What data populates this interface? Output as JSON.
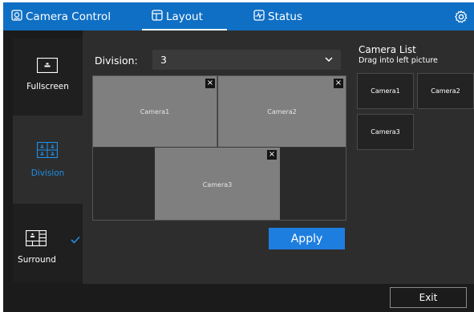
{
  "tabs": [
    {
      "label": "Camera Control",
      "icon": "camera-control-icon",
      "active": false
    },
    {
      "label": "Layout",
      "icon": "layout-icon",
      "active": true
    },
    {
      "label": "Status",
      "icon": "status-icon",
      "active": false
    }
  ],
  "settings_icon": "gear-icon",
  "sidebar": {
    "items": [
      {
        "label": "Fullscreen",
        "icon": "fullscreen-icon",
        "selected": false
      },
      {
        "label": "Division",
        "icon": "division-icon",
        "selected": true
      },
      {
        "label": "Surround",
        "icon": "surround-icon",
        "selected": false,
        "checked": true
      }
    ]
  },
  "division": {
    "label": "Division:",
    "value": "3"
  },
  "grid": {
    "cells": [
      {
        "label": "Camera1",
        "close": "×"
      },
      {
        "label": "Camera2",
        "close": "×"
      },
      {
        "label": "Camera3",
        "close": "×"
      }
    ]
  },
  "apply_label": "Apply",
  "camera_list": {
    "title": "Camera List",
    "subtitle": "Drag into left picture",
    "cameras": [
      "Camera1",
      "Camera2",
      "Camera3"
    ]
  },
  "exit_label": "Exit",
  "colors": {
    "accent": "#1e7ee0",
    "topbar": "#0f6fc4",
    "background": "#1b1b1b",
    "panel": "#2d2d2d"
  }
}
